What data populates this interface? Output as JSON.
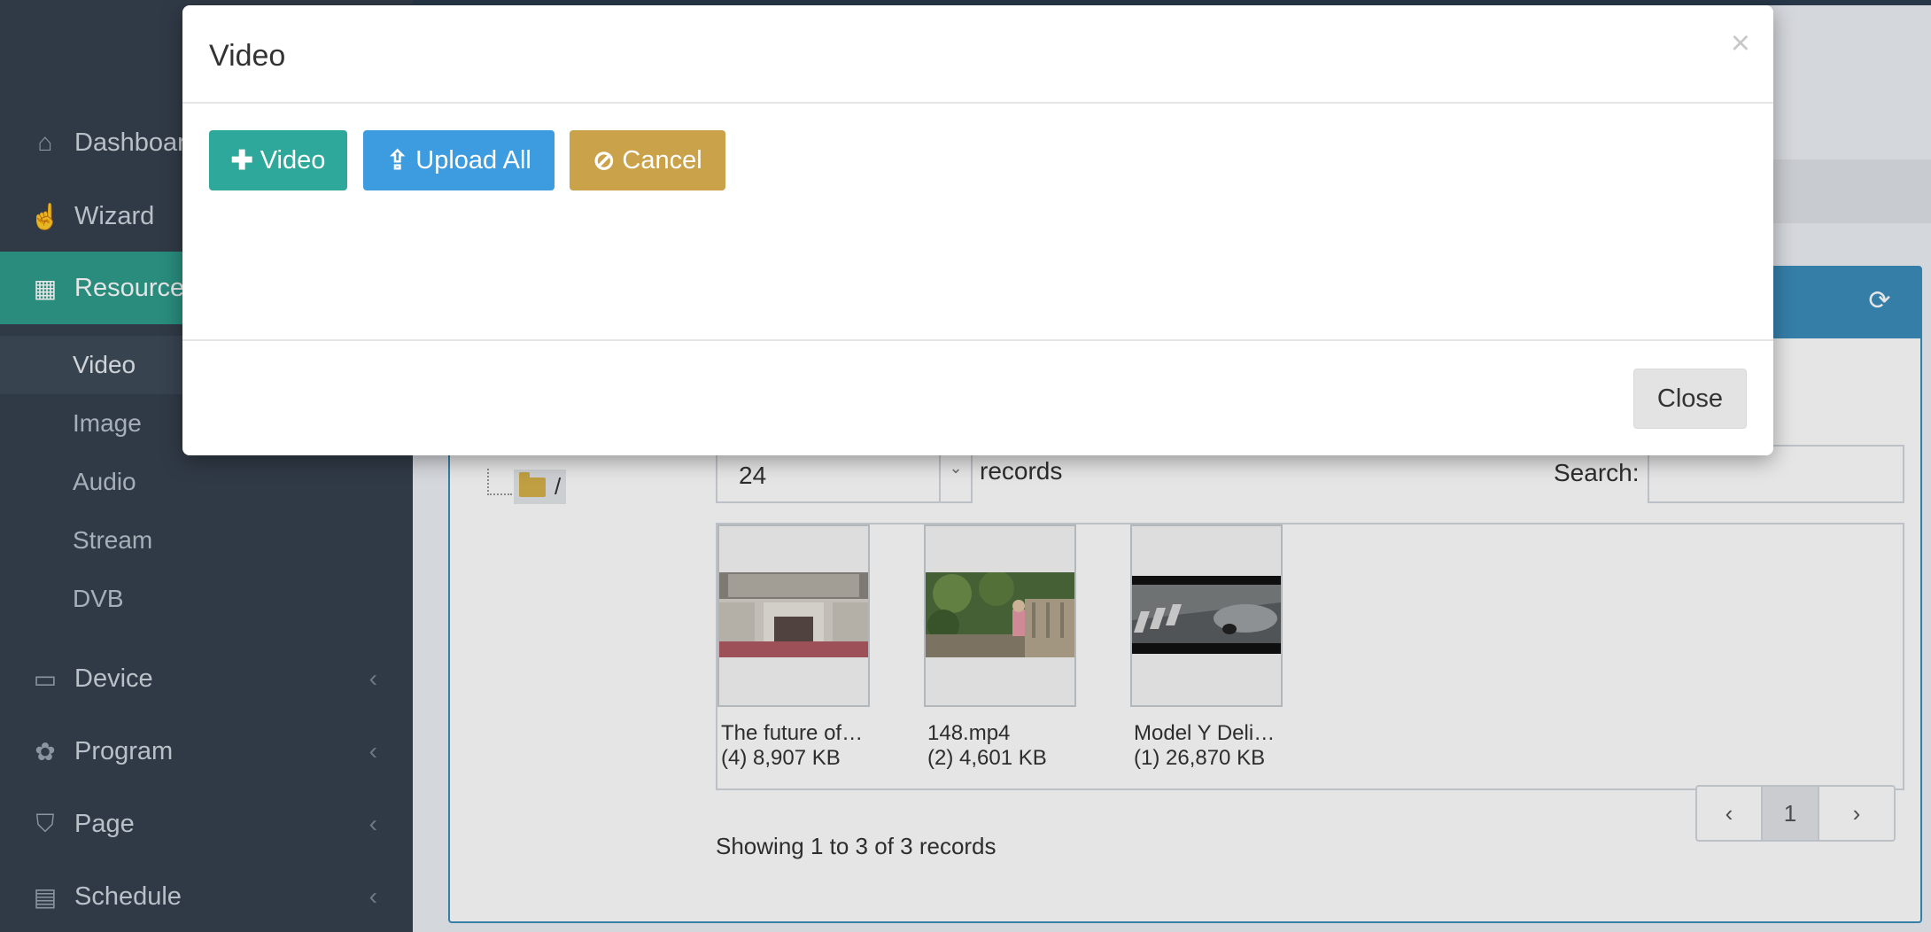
{
  "sidebar": {
    "items": [
      {
        "label": "Dashboard",
        "icon": "home-icon"
      },
      {
        "label": "Wizard",
        "icon": "hand-pointer-icon"
      },
      {
        "label": "Resource",
        "icon": "qrcode-icon"
      },
      {
        "label": "Device",
        "icon": "desktop-icon"
      },
      {
        "label": "Program",
        "icon": "paw-icon"
      },
      {
        "label": "Page",
        "icon": "html5-icon"
      },
      {
        "label": "Schedule",
        "icon": "calendar-icon"
      }
    ],
    "sub_items": [
      "Video",
      "Image",
      "Audio",
      "Stream",
      "DVB"
    ]
  },
  "main": {
    "tree_root": "/",
    "page_length": "24",
    "records_label": "records",
    "search_label": "Search:",
    "search_value": "",
    "cards": [
      {
        "name": "The future of…",
        "meta": "(4) 8,907 KB"
      },
      {
        "name": "148.mp4",
        "meta": "(2) 4,601 KB"
      },
      {
        "name": "Model Y Deli…",
        "meta": "(1) 26,870 KB"
      }
    ],
    "showing": "Showing 1 to 3 of 3 records",
    "pager": {
      "prev": "‹",
      "current": "1",
      "next": "›"
    }
  },
  "modal": {
    "title": "Video",
    "close_x": "×",
    "add_label": "Video",
    "upload_label": "Upload All",
    "cancel_label": "Cancel",
    "close_label": "Close"
  },
  "colors": {
    "sidebar_bg": "#36414f",
    "active_green": "#2e9c8c",
    "panel_blue": "#3c8dbc",
    "btn_add": "#2ea89a",
    "btn_upload": "#3d9be0",
    "btn_cancel": "#c9a24a"
  }
}
